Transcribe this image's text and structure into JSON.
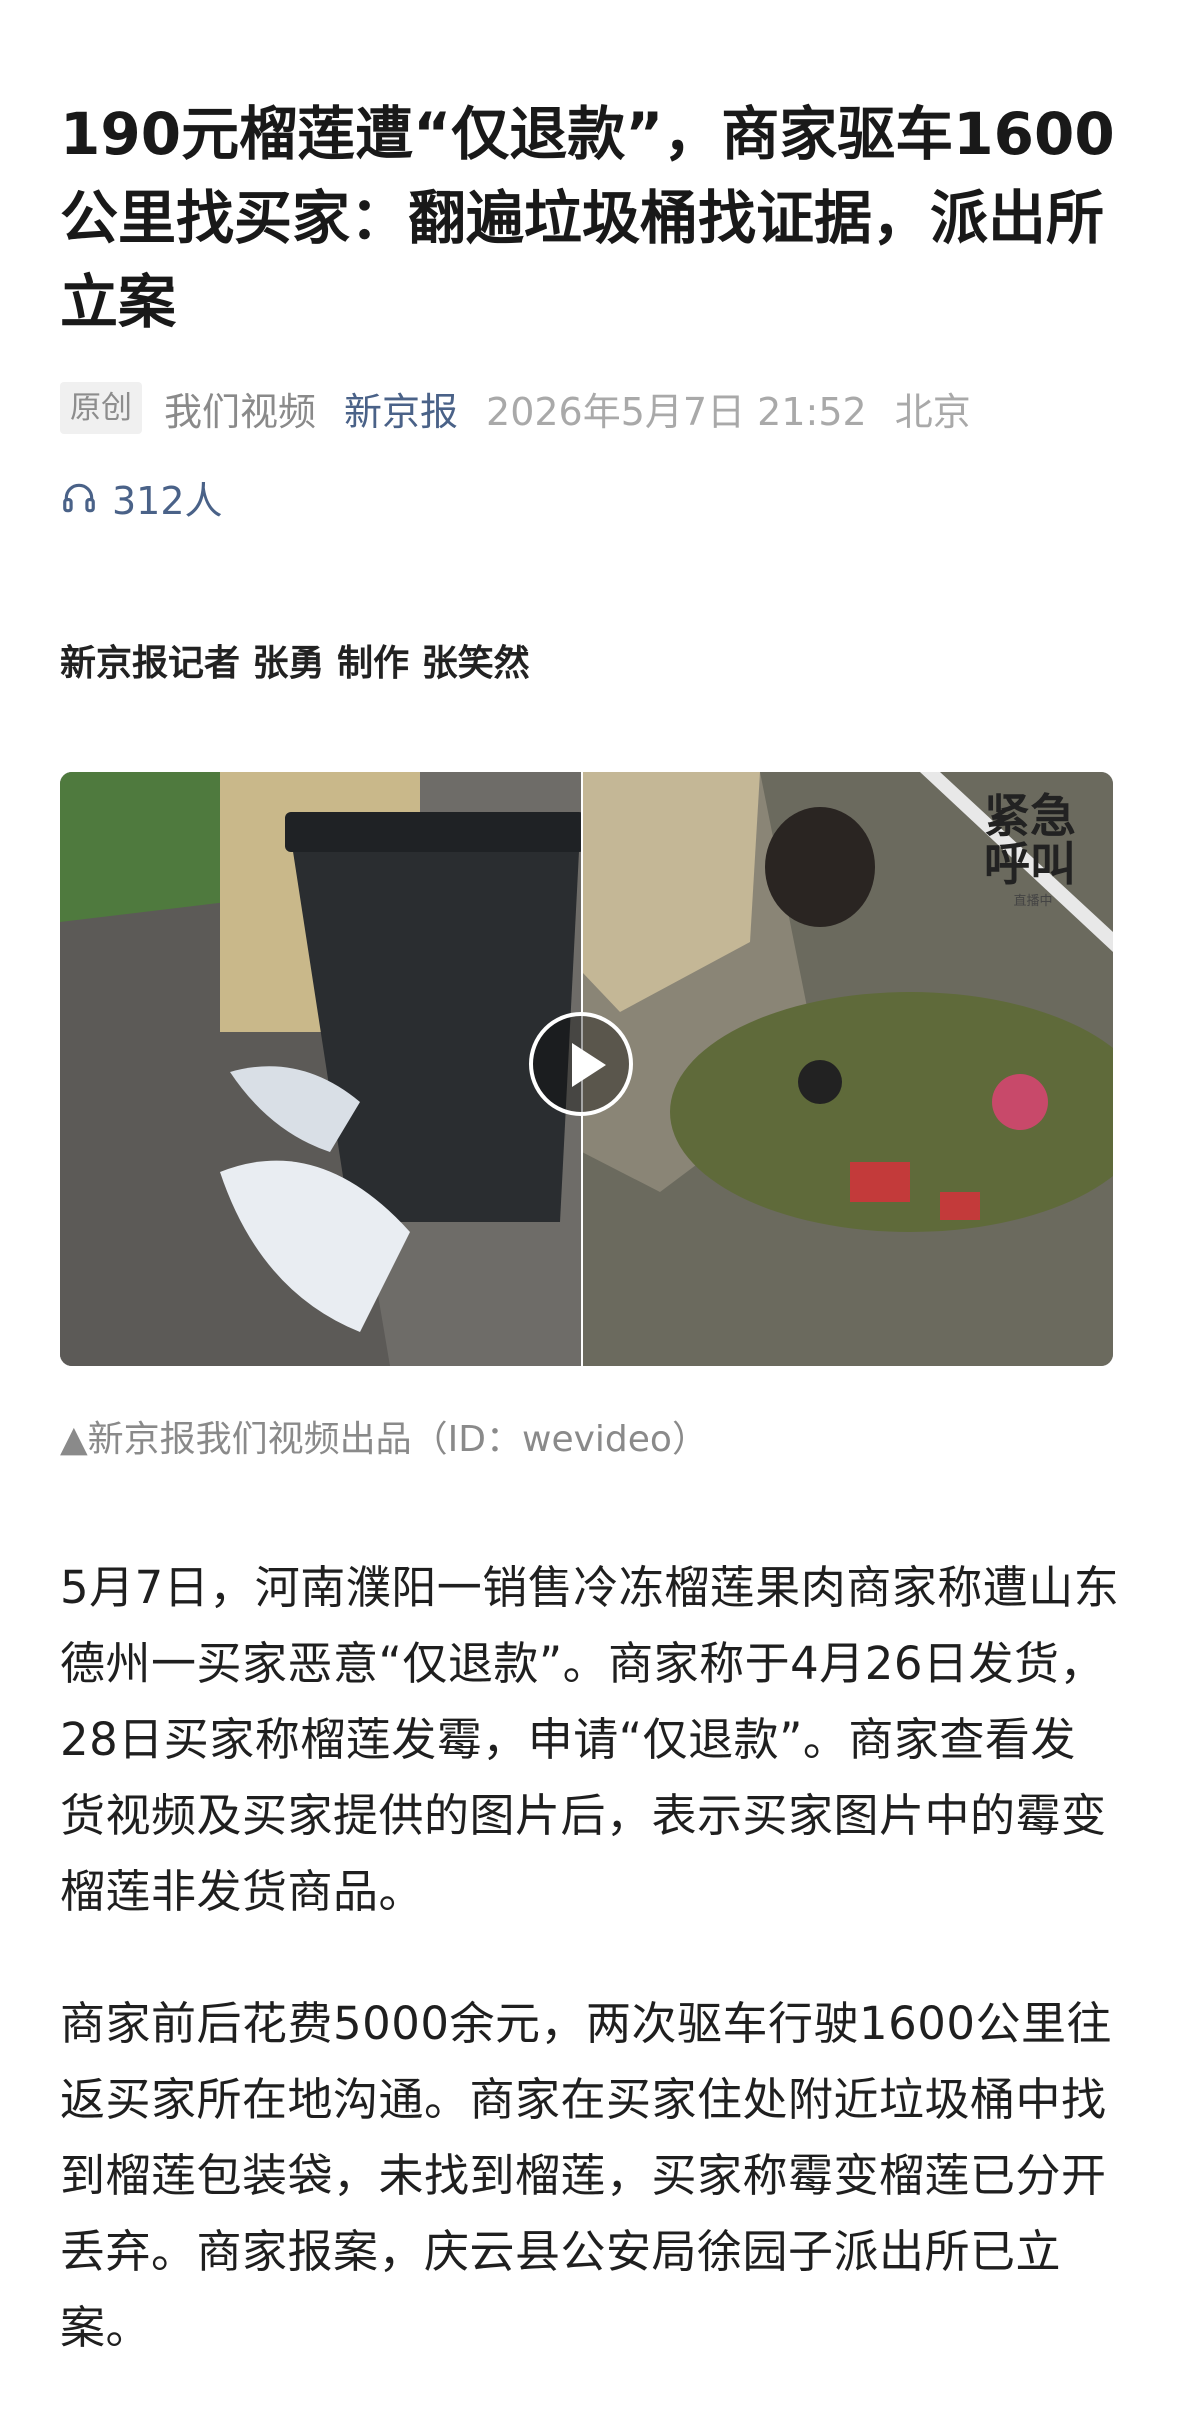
{
  "article": {
    "title": "190元榴莲遭“仅退款”，商家驱车1600公里找买家：翻遍垃圾桶找证据，派出所立案",
    "meta": {
      "tag": "原创",
      "channel": "我们视频",
      "source": "新京报",
      "date": "2026年5月7日 21:52",
      "location": "北京"
    },
    "listeners": "312人",
    "byline": "新京报记者 张勇 制作 张笑然",
    "video": {
      "watermark_title": "紧急呼叫",
      "watermark_subtitle": "直播中"
    },
    "caption": "▲新京报我们视频出品（ID：wevideo）",
    "paragraphs": [
      "5月7日，河南濮阳一销售冷冻榴莲果肉商家称遭山东德州一买家恶意“仅退款”。商家称于4月26日发货，28日买家称榴莲发霉，申请“仅退款”。商家查看发货视频及买家提供的图片后，表示买家图片中的霉变榴莲非发货商品。",
      "商家前后花费5000余元，两次驱车行驶1600公里往返买家所在地沟通。商家在买家住处附近垃圾桶中找到榴莲包装袋，未找到榴莲，买家称霉变榴莲已分开丢弃。商家报案，庆云县公安局徐园子派出所已立案。"
    ]
  },
  "colors": {
    "source_link": "#4a6288",
    "meta_gray": "#8a8a8a",
    "tag_bg": "#f0f0f0"
  },
  "icons": {
    "listeners": "headphones-icon",
    "play": "play-icon"
  }
}
